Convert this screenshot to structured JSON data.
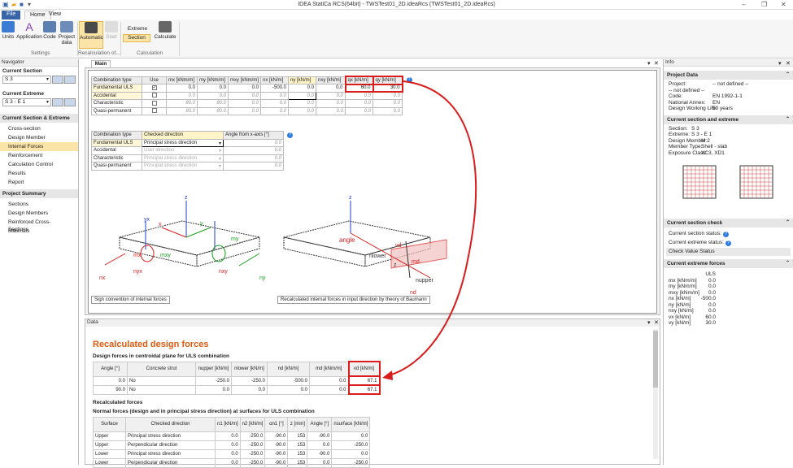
{
  "window": {
    "title": "IDEA StatiCa RCS(64bit) - TWSTest01_2D.ideaRcs (TWSTest01_2D.ideaRcs)"
  },
  "ribbon": {
    "tabs": [
      "File",
      "Home",
      "View"
    ],
    "buttons": {
      "units": "Units",
      "application": "Application",
      "code": "Code",
      "project_data_1": "Project",
      "project_data_2": "data",
      "automatic": "Automatic",
      "start": "Start",
      "extreme": "Extreme",
      "section": "Section",
      "calculate": "Calculate"
    },
    "groups": {
      "settings": "Settings",
      "recalc": "Recalculation of...",
      "calculation": "Calculation"
    }
  },
  "navigator": {
    "title": "Navigator",
    "current_section_label": "Current Section",
    "current_section_value": "S 3",
    "current_extreme_label": "Current Extreme",
    "current_extreme_value": "S 3 - E 1",
    "section_head": "Current Section & Extreme",
    "items": [
      "Cross-section",
      "Design Member",
      "Internal Forces",
      "Reinforcement",
      "Calculation Control",
      "Results",
      "Report"
    ],
    "summary_head": "Project Summary",
    "summary_items": [
      "Sections",
      "Design Members",
      "Reinforced Cross-Sections",
      "Materials"
    ]
  },
  "main": {
    "tab": "Main",
    "forces_table": {
      "headers": [
        "Combination type",
        "Use",
        "mx [kNm/m]",
        "my [kNm/m]",
        "mxy [kNm/m]",
        "nx [kN/m]",
        "ny [kN/m]",
        "nxy [kN/m]",
        "qx [kN/m]",
        "qy [kN/m]"
      ],
      "rows": [
        {
          "name": "Fundamental ULS",
          "use": true,
          "vals": [
            "0.0",
            "0.0",
            "0.0",
            "-500.0",
            "0.0",
            "0.0",
            "60.0",
            "30.0"
          ]
        },
        {
          "name": "Accidental",
          "use": false,
          "vals": [
            "0.0",
            "0.0",
            "0.0",
            "0.0",
            "0.0",
            "0.0",
            "0.0",
            "0.0"
          ]
        },
        {
          "name": "Characteristic",
          "use": false,
          "vals": [
            "80.0",
            "80.0",
            "0.0",
            "0.0",
            "0.0",
            "0.0",
            "0.0",
            "0.0"
          ]
        },
        {
          "name": "Quasi-permanent",
          "use": false,
          "vals": [
            "80.0",
            "80.0",
            "0.0",
            "0.0",
            "0.0",
            "0.0",
            "0.0",
            "0.0"
          ]
        }
      ]
    },
    "direction_table": {
      "headers": [
        "Combination type",
        "Checked direction",
        "Angle from x-axis [°]"
      ],
      "rows": [
        {
          "name": "Fundamental ULS",
          "dir": "Principal stress direction",
          "angle": "0.0"
        },
        {
          "name": "Accidental",
          "dir": "User direction",
          "angle": "0.0"
        },
        {
          "name": "Characteristic",
          "dir": "Principal stress direction",
          "angle": "0.0"
        },
        {
          "name": "Quasi-permanent",
          "dir": "Principal stress direction",
          "angle": "0.0"
        }
      ]
    },
    "captions": {
      "left": "Sign convention of internal forces",
      "right": "Recalculated internal forces in input direction by theory of Baumann"
    },
    "diagram_labels": {
      "z": "z",
      "x": "x",
      "y": "y",
      "yx": "yx",
      "mx": "mx",
      "my": "my",
      "mxy": "mxy",
      "nyx": "nyx",
      "nxy": "nxy",
      "nx": "nx",
      "ny": "ny",
      "angle": "angle",
      "nlower": "nlower",
      "nupper": "nupper",
      "nd": "nd",
      "md": "md",
      "vd": "vd",
      "zd": "z"
    }
  },
  "data": {
    "pane_title": "Data",
    "heading": "Recalculated design forces",
    "sub1": "Design forces in centroidal plane for ULS combination",
    "design_table": {
      "headers": [
        "Angle [°]",
        "Concrete strut",
        "nupper [kN/m]",
        "nlower [kN/m]",
        "nd [kN/m]",
        "md [kNm/m]",
        "vd [kN/m]"
      ],
      "rows": [
        [
          "0.0",
          "No",
          "-250.0",
          "-250.0",
          "-500.0",
          "0.0",
          "67.1"
        ],
        [
          "90.0",
          "No",
          "0.0",
          "0.0",
          "0.0",
          "0.0",
          "67.1"
        ]
      ]
    },
    "sub2": "Recalculated forces",
    "sub3": "Normal forces (design and in principal stress direction) at surfaces for ULS combination",
    "normal_table": {
      "headers": [
        "Surface",
        "Checked direction",
        "n1 [kN/m]",
        "n2 [kN/m]",
        "αn1 [°]",
        "z [mm]",
        "Angle [°]",
        "nsurface [kN/m]"
      ],
      "rows": [
        [
          "Upper",
          "Principal stress direction",
          "0.0",
          "-250.0",
          "-90.0",
          "153",
          "-90.0",
          "0.0"
        ],
        [
          "Upper",
          "Perpendicular direction",
          "0.0",
          "-250.0",
          "-90.0",
          "153",
          "0.0",
          "-250.0"
        ],
        [
          "Lower",
          "Principal stress direction",
          "0.0",
          "-250.0",
          "-90.0",
          "153",
          "-90.0",
          "0.0"
        ],
        [
          "Lower",
          "Perpendicular direction",
          "0.0",
          "-250.0",
          "-90.0",
          "153",
          "0.0",
          "-250.0"
        ]
      ]
    }
  },
  "info": {
    "title": "Info",
    "project_head": "Project Data",
    "project": [
      {
        "k": "Project:",
        "v": "-- not defined --"
      },
      {
        "k": "-- not defined --",
        "v": ""
      },
      {
        "k": "Code:",
        "v": "EN 1992-1-1"
      },
      {
        "k": "National Annex:",
        "v": "EN"
      },
      {
        "k": "Design Working Life:",
        "v": "50 years"
      }
    ],
    "section_head": "Current section and extreme",
    "section": [
      {
        "k": "Section:",
        "v": "S 3"
      },
      {
        "k": "Extreme:",
        "v": "S 3 - E 1"
      },
      {
        "k": "Design Member:",
        "v": "M 2"
      },
      {
        "k": "Member Type:",
        "v": "Shell - slab"
      },
      {
        "k": "Exposure Class:",
        "v": "XC3, XD1"
      }
    ],
    "check_head": "Current section check",
    "check": [
      "Current section status:",
      "Current extreme status:",
      "Check Value Status"
    ],
    "forces_head": "Current extreme forces",
    "forces_col": "ULS",
    "forces": [
      {
        "k": "mx [kNm/m]",
        "v": "0.0"
      },
      {
        "k": "my [kNm/m]",
        "v": "0.0"
      },
      {
        "k": "mxy [kNm/m]",
        "v": "0.0"
      },
      {
        "k": "nx [kN/m]",
        "v": "-500.0"
      },
      {
        "k": "ny [kN/m]",
        "v": "0.0"
      },
      {
        "k": "nxy [kN/m]",
        "v": "0.0"
      },
      {
        "k": "vx [kN/m]",
        "v": "60.0"
      },
      {
        "k": "vy [kN/m]",
        "v": "30.0"
      }
    ]
  },
  "colors": {
    "accent": "#3864a8",
    "highlight": "#d91c1c",
    "selected": "#fbe4a8",
    "heading_orange": "#e05a10"
  }
}
